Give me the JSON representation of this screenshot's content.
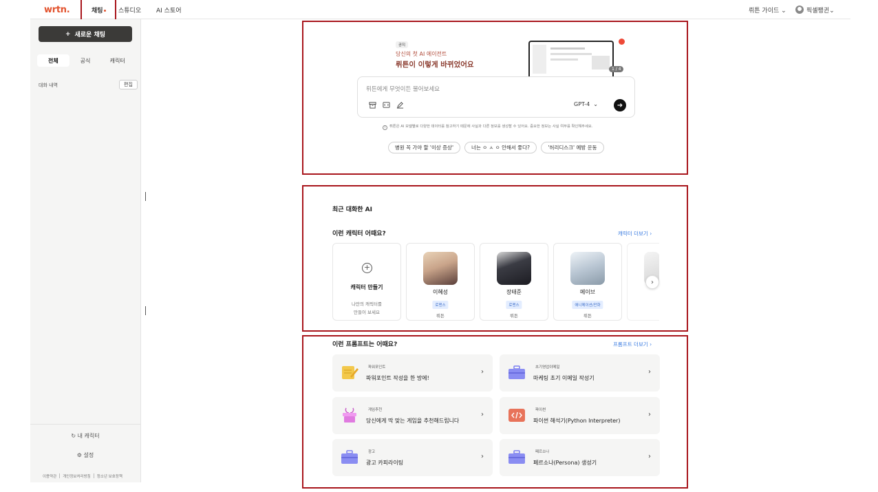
{
  "brand": {
    "logo": "wrtn."
  },
  "nav": {
    "tabs": [
      {
        "label": "채팅"
      },
      {
        "label": "스튜디오"
      },
      {
        "label": "AI 스토어"
      }
    ]
  },
  "header_right": {
    "guide": "뤼튼 가이드",
    "user": "픽셀팽귄"
  },
  "sidebar": {
    "new_chat": "새로운 채팅",
    "filters": [
      "전체",
      "공식",
      "캐릭터"
    ],
    "history_label": "대화 내역",
    "edit_label": "편집",
    "my_character": "내 캐릭터",
    "settings": "설정",
    "footer": [
      "이용약관",
      "개인정보처리방침",
      "청소년 보호정책"
    ]
  },
  "hero": {
    "notice_badge": "공지",
    "subtitle": "당신의 첫 AI 에이전트",
    "title": "뤼튼이 이렇게 바뀌었어요",
    "pager": "1 / 4",
    "prompt_placeholder": "뤼튼에게 무엇이든 물어보세요",
    "model": "GPT-4",
    "disclaimer": "뤼튼은 AI 모델별로 다양한 데이터를 참고하기 때문에 사실과 다른 정보를 생성할 수 있어요. 중요한 정보는 사실 여부를 확인해주세요.",
    "chips": [
      "병원 꼭 가야 할 '이상 증상'",
      "너는 ㅇ ㅅ ㅇ 안해서 좋다?",
      "'허리디스크' 예방 운동"
    ]
  },
  "recent": {
    "title": "최근 대화한 AI",
    "characters_title": "이런 캐릭터 어때요?",
    "more": "캐릭터 더보기",
    "create": {
      "title": "캐릭터 만들기",
      "desc_1": "나만의 캐릭터를",
      "desc_2": "만들어 보세요"
    },
    "cards": [
      {
        "name": "이혜성",
        "tag": "로맨스",
        "source": "뤼튼",
        "color": "#c9a48a"
      },
      {
        "name": "장태준",
        "tag": "로맨스",
        "source": "뤼튼",
        "color": "#3b3c44"
      },
      {
        "name": "메이브",
        "tag": "애니메이션/만화",
        "source": "뤼튼",
        "color": "#b9c6d3"
      }
    ]
  },
  "prompts": {
    "title": "이런 프롬프트는 어때요?",
    "more": "프롬프트 더보기",
    "items": [
      {
        "category": "파워포인트",
        "title": "파워포인트 작성을 한 방에!",
        "icon": "notepad-icon",
        "color": "#f3c84b"
      },
      {
        "category": "초기영업이메일",
        "title": "마케팅 초기 이메일 작성기",
        "icon": "briefcase-icon",
        "color": "#7b7ef0"
      },
      {
        "category": "게임추천",
        "title": "당신에게 딱 맞는 게임을 추천해드립니다",
        "icon": "gift-icon",
        "color": "#e07be0"
      },
      {
        "category": "파이썬",
        "title": "파이썬 해석기(Python Interpreter)",
        "icon": "code-icon",
        "color": "#e8735a"
      },
      {
        "category": "광고",
        "title": "광고 카피라이팅",
        "icon": "briefcase-icon",
        "color": "#7b7ef0"
      },
      {
        "category": "페르소나",
        "title": "페르소나(Persona) 생성기",
        "icon": "briefcase-icon",
        "color": "#7b7ef0"
      }
    ]
  }
}
